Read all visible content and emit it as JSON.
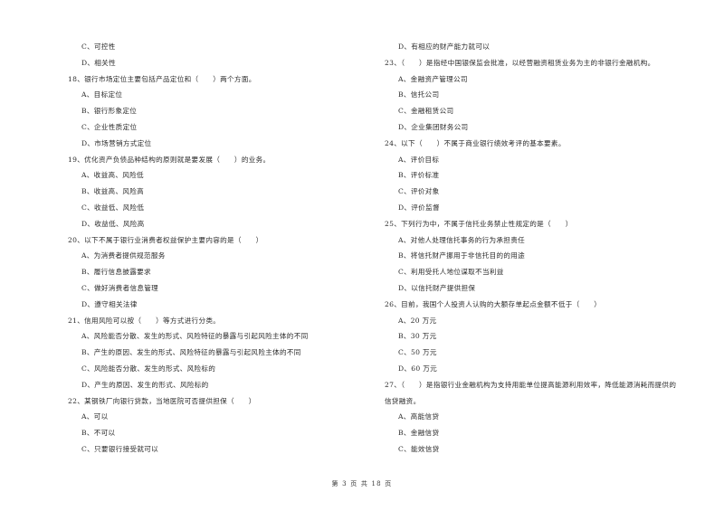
{
  "page": {
    "footer": "第 3 页 共 18 页"
  },
  "left_column": [
    {
      "type": "opt",
      "text": "C、可控性"
    },
    {
      "type": "opt",
      "text": "D、相关性"
    },
    {
      "type": "q",
      "text": "18、银行市场定位主要包括产品定位和（　　）两个方面。"
    },
    {
      "type": "opt",
      "text": "A、目标定位"
    },
    {
      "type": "opt",
      "text": "B、银行形象定位"
    },
    {
      "type": "opt",
      "text": "C、企业性质定位"
    },
    {
      "type": "opt",
      "text": "D、市场营销方式定位"
    },
    {
      "type": "q",
      "text": "19、优化资产负债品种结构的原则就是要发展（　　）的业务。"
    },
    {
      "type": "opt",
      "text": "A、收益高、风险低"
    },
    {
      "type": "opt",
      "text": "B、收益高、风险高"
    },
    {
      "type": "opt",
      "text": "C、收益低、风险低"
    },
    {
      "type": "opt",
      "text": "D、收益低、风险高"
    },
    {
      "type": "q",
      "text": "20、以下不属于银行业消费者权益保护主要内容的是（　　）"
    },
    {
      "type": "opt",
      "text": "A、为消费者提供规范服务"
    },
    {
      "type": "opt",
      "text": "B、履行信息披露要求"
    },
    {
      "type": "opt",
      "text": "C、做好消费者信息管理"
    },
    {
      "type": "opt",
      "text": "D、遵守相关法律"
    },
    {
      "type": "q",
      "text": "21、信用风险可以按（　　）等方式进行分类。"
    },
    {
      "type": "opt",
      "text": "A、风险能否分散、发生的形式、风险特征的暴露与引起风险主体的不同"
    },
    {
      "type": "opt",
      "text": "B、产生的原因、发生的形式、风险特征的暴露与引起风险主体的不同"
    },
    {
      "type": "opt",
      "text": "C、风险能否分散、发生的形式、风险标的"
    },
    {
      "type": "opt",
      "text": "D、产生的原因、发生的形式、风险标的"
    },
    {
      "type": "q",
      "text": "22、某钢铁厂向银行贷款，当地医院可否提供担保（　　）"
    },
    {
      "type": "opt",
      "text": "A、可以"
    },
    {
      "type": "opt",
      "text": "B、不可以"
    },
    {
      "type": "opt",
      "text": "C、只要银行接受就可以"
    }
  ],
  "right_column": [
    {
      "type": "opt",
      "text": "D、有相应的财产能力就可以"
    },
    {
      "type": "q",
      "text": "23、（　　）是指经中国银保监会批准，以经营融资租赁业务为主的非银行金融机构。"
    },
    {
      "type": "opt",
      "text": "A、金融资产管理公司"
    },
    {
      "type": "opt",
      "text": "B、信托公司"
    },
    {
      "type": "opt",
      "text": "C、金融租赁公司"
    },
    {
      "type": "opt",
      "text": "D、企业集团财务公司"
    },
    {
      "type": "q",
      "text": "24、以下（　　）不属于商业银行绩效考评的基本要素。"
    },
    {
      "type": "opt",
      "text": "A、评价目标"
    },
    {
      "type": "opt",
      "text": "B、评价标准"
    },
    {
      "type": "opt",
      "text": "C、评价对象"
    },
    {
      "type": "opt",
      "text": "D、评价监督"
    },
    {
      "type": "q",
      "text": "25、下列行为中，不属于信托业务禁止性规定的是（　　）"
    },
    {
      "type": "opt",
      "text": "A、对他人处理信托事务的行为承担责任"
    },
    {
      "type": "opt",
      "text": "B、将信托财产挪用于非信托目的的用途"
    },
    {
      "type": "opt",
      "text": "C、利用受托人地位谋取不当利益"
    },
    {
      "type": "opt",
      "text": "D、以信托财产提供担保"
    },
    {
      "type": "q",
      "text": "26、目前，我国个人投资人认购的大额存单起点金额不低于（　　）"
    },
    {
      "type": "opt",
      "text": "A、20 万元"
    },
    {
      "type": "opt",
      "text": "B、30 万元"
    },
    {
      "type": "opt",
      "text": "C、50 万元"
    },
    {
      "type": "opt",
      "text": "D、60 万元"
    },
    {
      "type": "q",
      "text": "27、（　　）是指银行业金融机构为支持用能单位提高能源利用效率，降低能源消耗而提供的"
    },
    {
      "type": "q",
      "text": "信贷融资。"
    },
    {
      "type": "opt",
      "text": "A、高能信贷"
    },
    {
      "type": "opt",
      "text": "B、金融信贷"
    },
    {
      "type": "opt",
      "text": "C、能效信贷"
    }
  ]
}
